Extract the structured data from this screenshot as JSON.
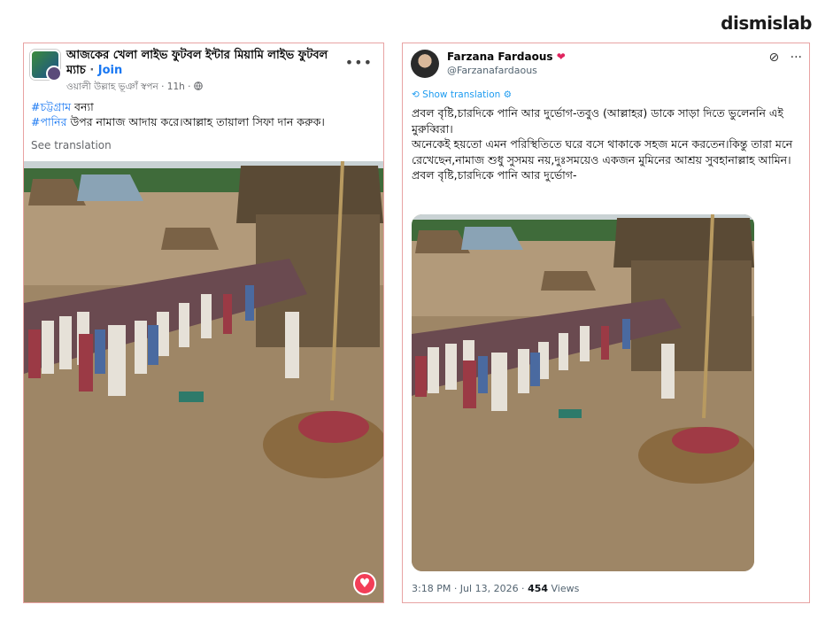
{
  "brand": "dismislab",
  "facebook_post": {
    "group_title": "আজকের খেলা লাইভ ফুটবল ইন্টার মিয়ামি লাইভ ফুটবল ম্যাচ",
    "join_label": "Join",
    "author_line": "ওয়ালী উল্লাহ ভূঞাঁ স্বপন · 11h · ",
    "more_icon": "more-horizontal-icon",
    "line1_hashtag": "#চট্টগ্রাম",
    "line1_text": " বন্যা",
    "line2_hashtag": "#পানির",
    "line2_text": " উপর নামাজ আদায় করে।আল্লাহ তায়ালা সিফা দান করুক।",
    "see_translation": "See translation",
    "reaction_icon": "heart-reaction-icon"
  },
  "tweet": {
    "display_name": "Farzana Fardaous",
    "handle": "@Farzanafardaous",
    "show_translation": "Show translation",
    "paragraph1": "প্রবল বৃষ্টি,চারদিকে পানি আর দুর্ভোগ-তবুও (আল্লাহর) ডাকে সাড়া দিতে ভুলেননি এই মুরুব্বিরা।",
    "paragraph2": "অনেকেই হয়তো এমন পরিস্থিতিতে ঘরে বসে থাকাকে সহজ মনে করতেন।কিন্তু তারা মনে রেখেছেন,নামাজ শুধু সুসময় নয়,দুঃসময়েও একজন মুমিনের আশ্রয় সুবহানাল্লাহ আমিন।",
    "paragraph3": "প্রবল বৃষ্টি,চারদিকে পানি আর দুর্ভোগ-",
    "timestamp": "3:18 PM · Jul 13, 2026 · ",
    "views_count": "454",
    "views_label": " Views"
  }
}
